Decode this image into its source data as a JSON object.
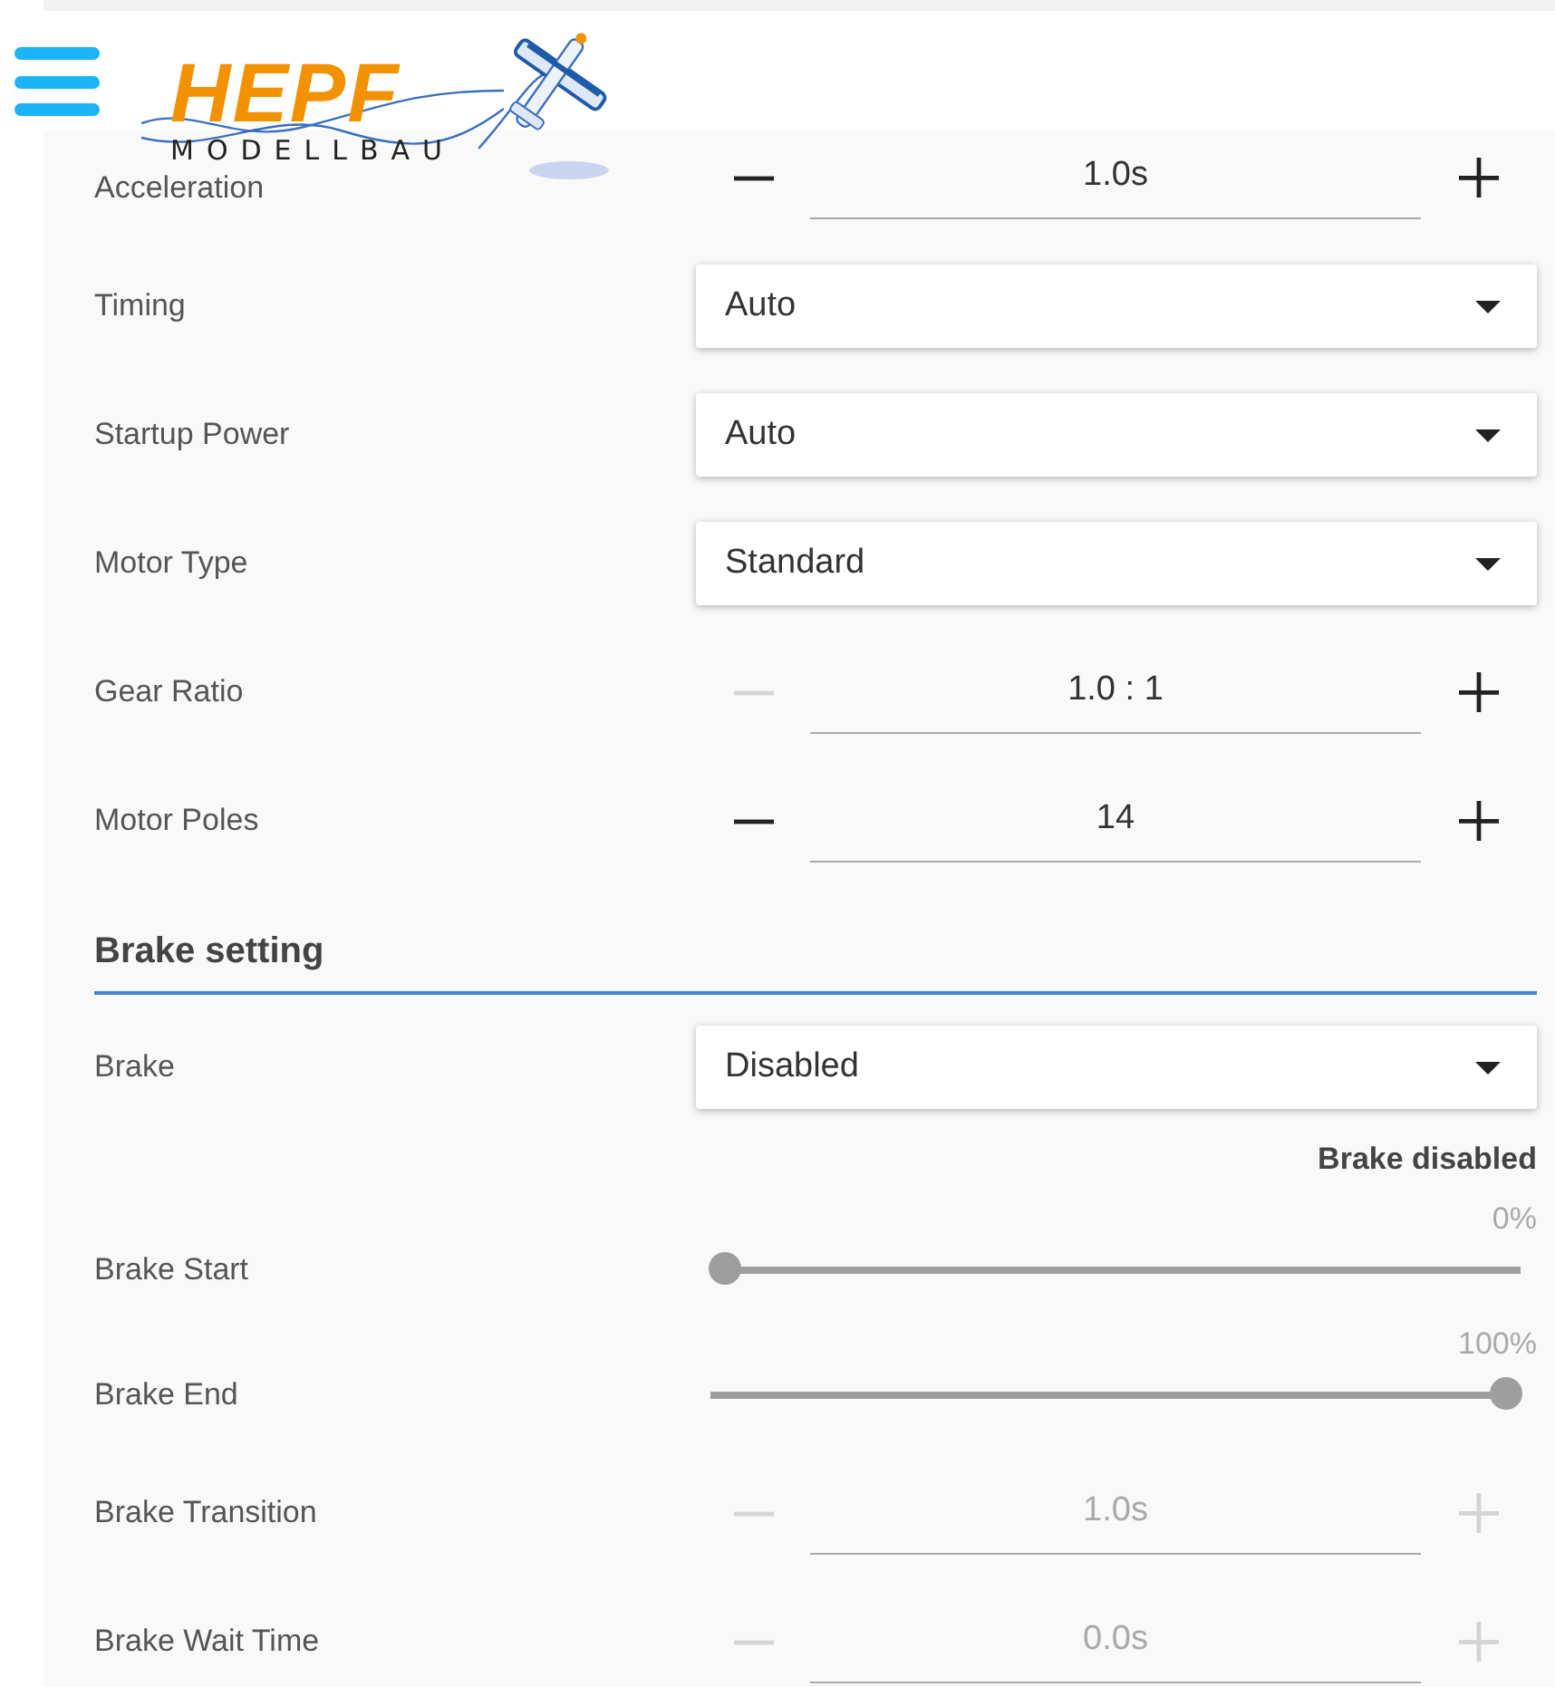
{
  "header": {
    "logo": {
      "title": "HEPF",
      "subtitle": "MODELLBAU"
    }
  },
  "settings": [
    {
      "kind": "stepper",
      "label": "Acceleration",
      "value": "1.0s",
      "disabled": false,
      "minus_disabled": false,
      "plus_disabled": false
    },
    {
      "kind": "select",
      "label": "Timing",
      "value": "Auto"
    },
    {
      "kind": "select",
      "label": "Startup Power",
      "value": "Auto"
    },
    {
      "kind": "select",
      "label": "Motor Type",
      "value": "Standard"
    },
    {
      "kind": "stepper",
      "label": "Gear Ratio",
      "value": "1.0 : 1",
      "disabled": false,
      "minus_disabled": true,
      "plus_disabled": false
    },
    {
      "kind": "stepper",
      "label": "Motor Poles",
      "value": "14",
      "disabled": false,
      "minus_disabled": false,
      "plus_disabled": false
    },
    {
      "kind": "heading",
      "label": "Brake setting"
    },
    {
      "kind": "select",
      "label": "Brake",
      "value": "Disabled"
    },
    {
      "kind": "note",
      "text": "Brake disabled"
    },
    {
      "kind": "slider",
      "label": "Brake Start",
      "reading": "0%",
      "level": 0,
      "disabled": true
    },
    {
      "kind": "slider",
      "label": "Brake End",
      "reading": "100%",
      "level": 1,
      "disabled": true
    },
    {
      "kind": "stepper",
      "label": "Brake Transition",
      "value": "1.0s",
      "disabled": true,
      "minus_disabled": true,
      "plus_disabled": true
    },
    {
      "kind": "stepper",
      "label": "Brake Wait Time",
      "value": "0.0s",
      "disabled": true,
      "minus_disabled": true,
      "plus_disabled": true
    }
  ]
}
